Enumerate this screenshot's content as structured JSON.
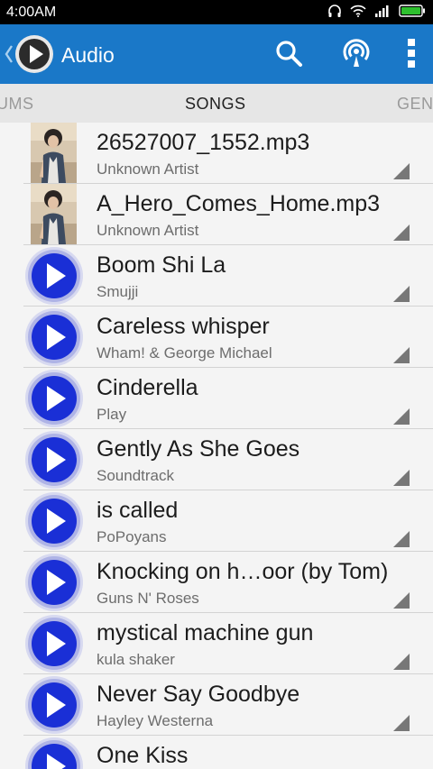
{
  "status_bar": {
    "time": "4:00AM",
    "icons": [
      "headphones-icon",
      "wifi-icon",
      "signal-icon",
      "battery-icon"
    ]
  },
  "action_bar": {
    "title": "Audio",
    "color": "#1a78c8",
    "actions": [
      "search-icon",
      "cast-icon",
      "overflow-menu-icon"
    ]
  },
  "tabs": [
    {
      "label": "UMS"
    },
    {
      "label": "SONGS",
      "active": true
    },
    {
      "label": "GEN"
    }
  ],
  "songs": [
    {
      "title": "26527007_1552.mp3",
      "artist": "Unknown Artist",
      "thumb": "photo"
    },
    {
      "title": "A_Hero_Comes_Home.mp3",
      "artist": "Unknown Artist",
      "thumb": "photo"
    },
    {
      "title": "Boom Shi La",
      "artist": "Smujji",
      "thumb": "play"
    },
    {
      "title": "Careless whisper",
      "artist": "Wham! & George Michael",
      "thumb": "play"
    },
    {
      "title": "Cinderella",
      "artist": "Play",
      "thumb": "play"
    },
    {
      "title": "Gently As She Goes",
      "artist": "Soundtrack",
      "thumb": "play"
    },
    {
      "title": "is called",
      "artist": "PoPoyans",
      "thumb": "play"
    },
    {
      "title": "Knocking on h…oor (by Tom)",
      "artist": "Guns N' Roses",
      "thumb": "play"
    },
    {
      "title": "mystical machine gun",
      "artist": "kula shaker",
      "thumb": "play"
    },
    {
      "title": "Never Say Goodbye",
      "artist": "Hayley Westerna",
      "thumb": "play"
    },
    {
      "title": "One Kiss",
      "artist": "",
      "thumb": "play"
    }
  ]
}
